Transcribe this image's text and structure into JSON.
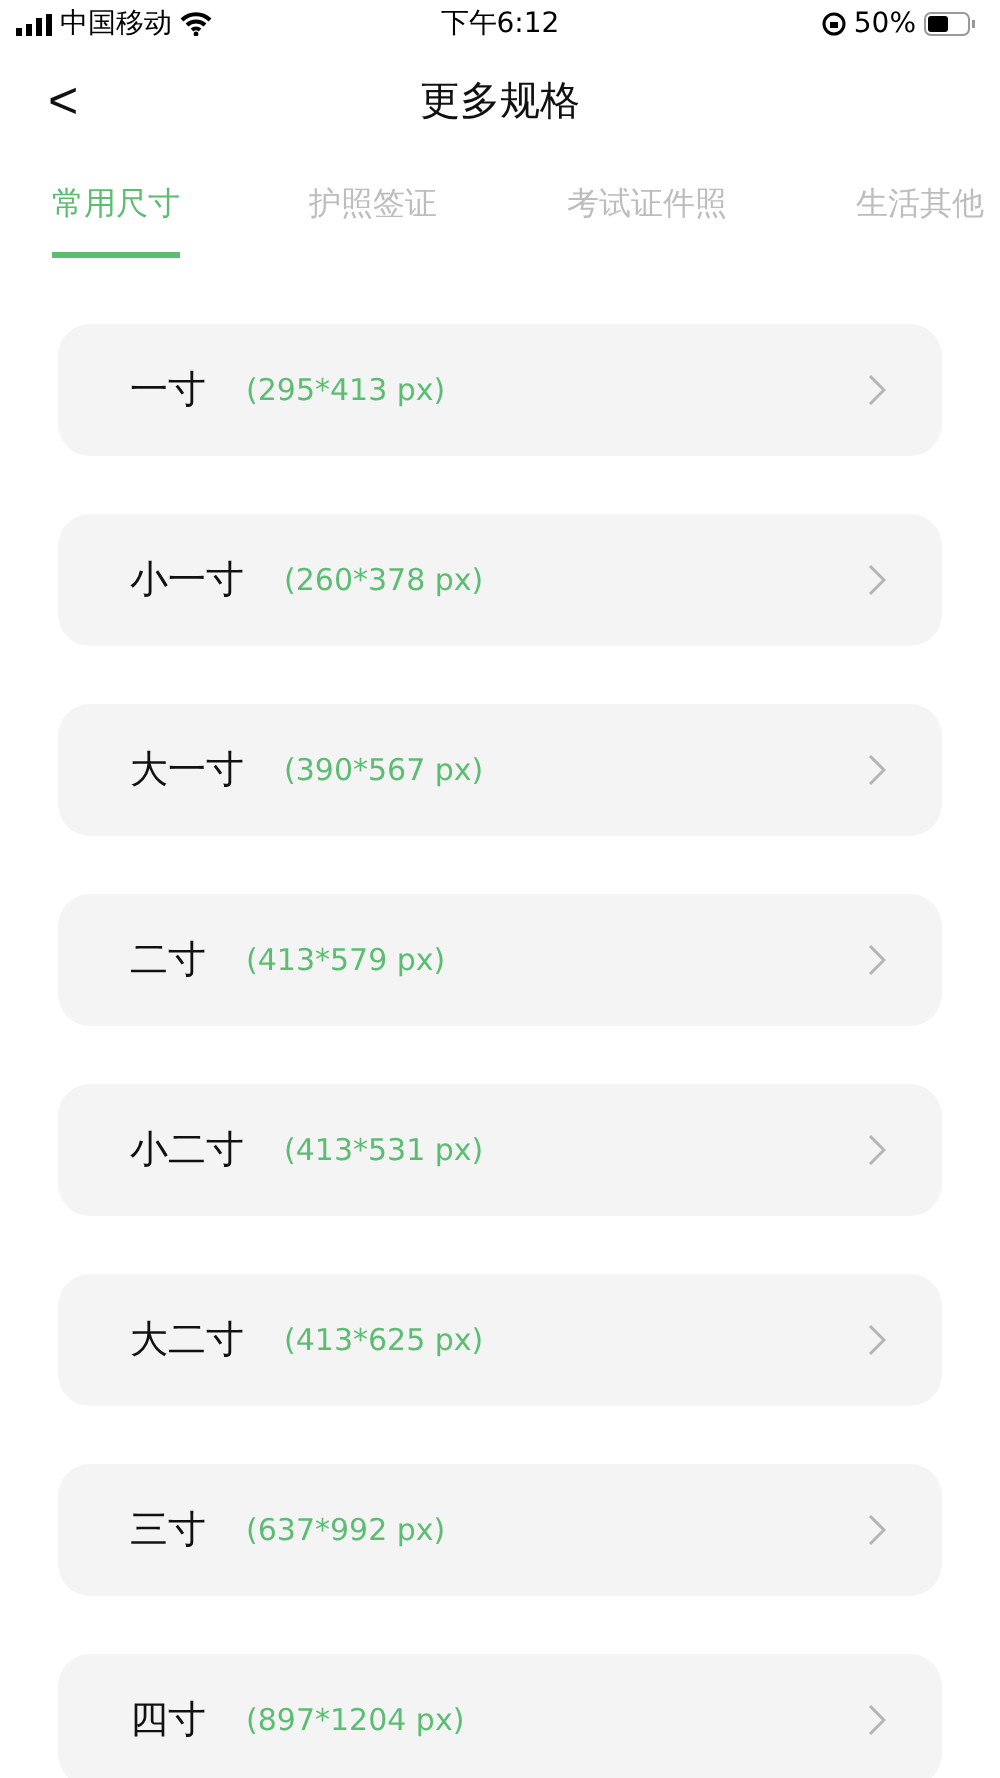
{
  "status_bar": {
    "carrier": "中国移动",
    "time": "下午6:12",
    "battery": "50%"
  },
  "header": {
    "back": "<",
    "title": "更多规格"
  },
  "tabs": [
    {
      "label": "常用尺寸",
      "selected": true
    },
    {
      "label": "护照签证",
      "selected": false
    },
    {
      "label": "考试证件照",
      "selected": false
    },
    {
      "label": "生活其他",
      "selected": false
    }
  ],
  "sizes": [
    {
      "name": "一寸",
      "dims": "(295*413 px)"
    },
    {
      "name": "小一寸",
      "dims": "(260*378 px)"
    },
    {
      "name": "大一寸",
      "dims": "(390*567 px)"
    },
    {
      "name": "二寸",
      "dims": "(413*579 px)"
    },
    {
      "name": "小二寸",
      "dims": "(413*531 px)"
    },
    {
      "name": "大二寸",
      "dims": "(413*625 px)"
    },
    {
      "name": "三寸",
      "dims": "(637*992 px)"
    },
    {
      "name": "四寸",
      "dims": "(897*1204 px)"
    }
  ]
}
